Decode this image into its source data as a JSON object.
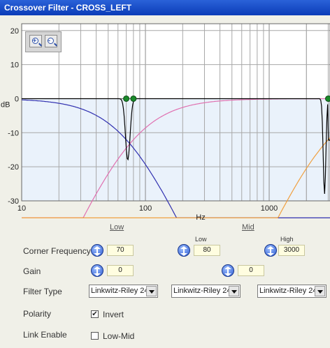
{
  "window": {
    "title": "Crossover Filter - CROSS_LEFT"
  },
  "plot": {
    "y_unit": "dB",
    "x_unit": "Hz",
    "y_ticks": [
      "20",
      "10",
      "0",
      "-10",
      "-20",
      "-30"
    ],
    "x_ticks": [
      "10",
      "100",
      "1000"
    ],
    "xlim": [
      10,
      3100
    ],
    "ylim": [
      -30,
      22
    ],
    "markers_hz": [
      70,
      80,
      3000
    ],
    "colors": {
      "grid": "#a8a8a8",
      "fill": "#eaf2fb",
      "black": "#000000",
      "blue": "#3030b0",
      "pink": "#e070b0",
      "orange": "#f0a040",
      "marker": "#1a8a2a"
    }
  },
  "zoom": {
    "in_label": "+",
    "out_label": "-"
  },
  "bands": {
    "low": "Low",
    "mid": "Mid"
  },
  "corner_frequency": {
    "label": "Corner Frequency",
    "low_header": "Low",
    "high_header": "High",
    "values": [
      "70",
      "80",
      "3000"
    ]
  },
  "gain": {
    "label": "Gain",
    "values": [
      "0",
      "0"
    ]
  },
  "filter_type": {
    "label": "Filter Type",
    "values": [
      "Linkwitz-Riley 24",
      "Linkwitz-Riley 24",
      "Linkwitz-Riley 24"
    ]
  },
  "polarity": {
    "label": "Polarity",
    "invert_label": "Invert",
    "invert_checked": true
  },
  "link_enable": {
    "label": "Link Enable",
    "lowmid_label": "Low-Mid",
    "lowmid_checked": false
  }
}
